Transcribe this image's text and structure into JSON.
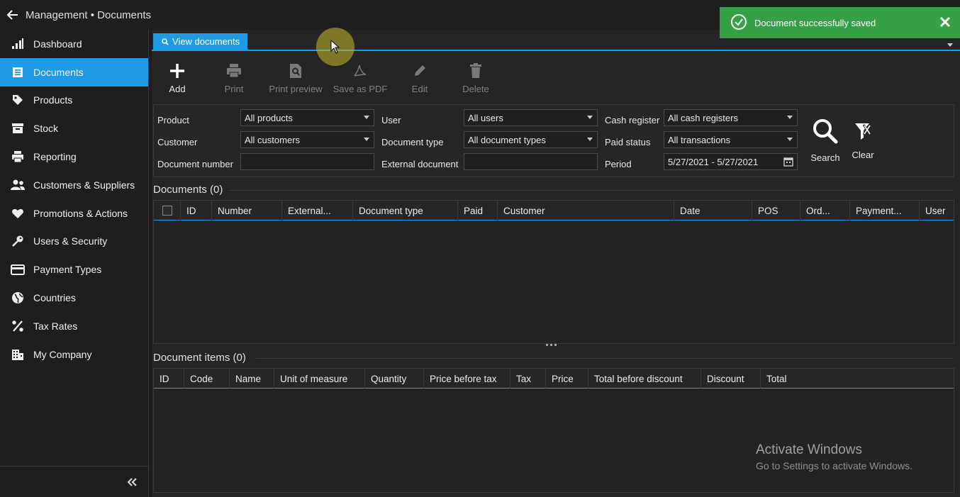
{
  "window": {
    "breadcrumb": "Management • Documents"
  },
  "sidebar": {
    "items": [
      {
        "label": "Dashboard",
        "icon": "bar-chart-icon"
      },
      {
        "label": "Documents",
        "icon": "document-list-icon",
        "active": true
      },
      {
        "label": "Products",
        "icon": "tag-icon"
      },
      {
        "label": "Stock",
        "icon": "box-icon"
      },
      {
        "label": "Reporting",
        "icon": "printer-icon"
      },
      {
        "label": "Customers & Suppliers",
        "icon": "users-icon"
      },
      {
        "label": "Promotions & Actions",
        "icon": "heart-icon"
      },
      {
        "label": "Users & Security",
        "icon": "key-icon"
      },
      {
        "label": "Payment Types",
        "icon": "credit-card-icon"
      },
      {
        "label": "Countries",
        "icon": "globe-icon"
      },
      {
        "label": "Tax Rates",
        "icon": "percent-icon"
      },
      {
        "label": "My Company",
        "icon": "building-icon"
      }
    ]
  },
  "tabs": [
    {
      "label": "View documents",
      "icon": "search-icon"
    }
  ],
  "toolbar": {
    "add": "Add",
    "print": "Print",
    "print_preview": "Print preview",
    "save_pdf": "Save as PDF",
    "edit": "Edit",
    "delete": "Delete"
  },
  "filters": {
    "product_label": "Product",
    "product_value": "All products",
    "customer_label": "Customer",
    "customer_value": "All customers",
    "docnum_label": "Document number",
    "docnum_value": "",
    "user_label": "User",
    "user_value": "All users",
    "doctype_label": "Document type",
    "doctype_value": "All document types",
    "extdoc_label": "External document",
    "extdoc_value": "",
    "cashreg_label": "Cash register",
    "cashreg_value": "All cash registers",
    "paid_label": "Paid status",
    "paid_value": "All transactions",
    "period_label": "Period",
    "period_value": "5/27/2021 - 5/27/2021",
    "search": "Search",
    "clear": "Clear"
  },
  "documents": {
    "title": "Documents (0)",
    "columns": [
      "ID",
      "Number",
      "External...",
      "Document type",
      "Paid",
      "Customer",
      "Date",
      "POS",
      "Ord...",
      "Payment...",
      "User"
    ]
  },
  "items": {
    "title": "Document items (0)",
    "columns": [
      "ID",
      "Code",
      "Name",
      "Unit of measure",
      "Quantity",
      "Price before tax",
      "Tax",
      "Price",
      "Total before discount",
      "Discount",
      "Total"
    ]
  },
  "toast": {
    "message": "Document successfully saved"
  },
  "watermark": {
    "line1": "Activate Windows",
    "line2": "Go to Settings to activate Windows."
  },
  "colors": {
    "accent": "#1f9ae5",
    "success": "#35a046",
    "background": "#1e1e1e"
  }
}
